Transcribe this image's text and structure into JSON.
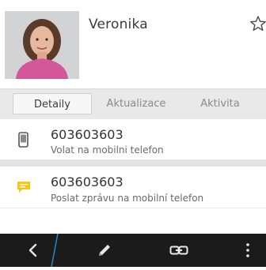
{
  "contact": {
    "name": "Veronika"
  },
  "tabs": [
    {
      "label": "Detaily",
      "active": true
    },
    {
      "label": "Aktualizace",
      "active": false
    },
    {
      "label": "Aktivita",
      "active": false
    }
  ],
  "entries": [
    {
      "number": "603603603",
      "action": "Volat na mobilni telefon",
      "icon": "mobile-phone-icon"
    },
    {
      "number": "603603603",
      "action": "Poslat zprávu na mobilní telefon",
      "icon": "message-icon"
    }
  ],
  "toolbar": {
    "icons": [
      "back-icon",
      "edit-pencil-icon",
      "link-icon",
      "more-options-icon"
    ]
  },
  "colors": {
    "tabs_background": "#e9e9e9",
    "message_icon": "#f5c518",
    "bottom_bar": "#1b1b1b",
    "accent_line": "#2a8bd6"
  }
}
